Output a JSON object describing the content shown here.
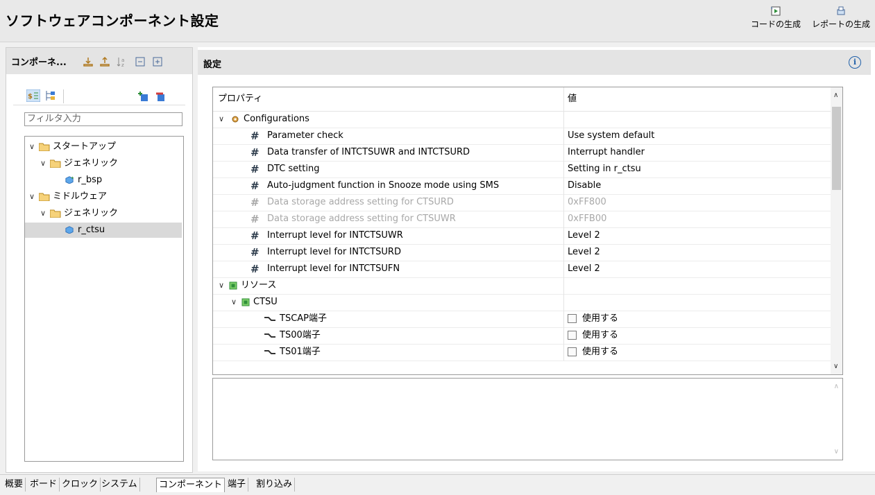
{
  "header": {
    "title": "ソフトウェアコンポーネント設定",
    "generate_code": "コードの生成",
    "generate_report": "レポートの生成"
  },
  "left_panel": {
    "title": "コンポーネ...",
    "filter_placeholder": "フィルタ入力",
    "tree": [
      {
        "label": "スタートアップ",
        "level": 0,
        "type": "folder",
        "expanded": true
      },
      {
        "label": "ジェネリック",
        "level": 1,
        "type": "folder",
        "expanded": true
      },
      {
        "label": "r_bsp",
        "level": 2,
        "type": "component"
      },
      {
        "label": "ミドルウェア",
        "level": 0,
        "type": "folder",
        "expanded": true
      },
      {
        "label": "ジェネリック",
        "level": 1,
        "type": "folder",
        "expanded": true
      },
      {
        "label": "r_ctsu",
        "level": 2,
        "type": "component",
        "selected": true
      }
    ]
  },
  "right_panel": {
    "title": "設定",
    "columns": {
      "property": "プロパティ",
      "value": "値"
    },
    "groups": {
      "configurations": "Configurations",
      "resources": "リソース",
      "ctsu": "CTSU"
    },
    "properties": [
      {
        "name": "Parameter check",
        "value": "Use system default",
        "disabled": false
      },
      {
        "name": "Data transfer of INTCTSUWR and INTCTSURD",
        "value": "Interrupt handler",
        "disabled": false
      },
      {
        "name": "DTC setting",
        "value": "Setting in r_ctsu",
        "disabled": false
      },
      {
        "name": "Auto-judgment function in Snooze mode using SMS",
        "value": "Disable",
        "disabled": false
      },
      {
        "name": "Data storage address setting for CTSURD",
        "value": "0xFF800",
        "disabled": true
      },
      {
        "name": "Data storage address setting for CTSUWR",
        "value": "0xFFB00",
        "disabled": true
      },
      {
        "name": "Interrupt level for INTCTSUWR",
        "value": "Level 2",
        "disabled": false
      },
      {
        "name": "Interrupt level for INTCTSURD",
        "value": "Level 2",
        "disabled": false
      },
      {
        "name": "Interrupt level for INTCTSUFN",
        "value": "Level 2",
        "disabled": false
      }
    ],
    "pins": [
      {
        "name": "TSCAP端子",
        "checkbox_label": "使用する",
        "checked": false
      },
      {
        "name": "TS00端子",
        "checkbox_label": "使用する",
        "checked": false
      },
      {
        "name": "TS01端子",
        "checkbox_label": "使用する",
        "checked": false
      }
    ]
  },
  "tabs": [
    {
      "label": "概要",
      "active": false
    },
    {
      "label": "ボード",
      "active": false
    },
    {
      "label": "クロック",
      "active": false
    },
    {
      "label": "システム",
      "active": false
    },
    {
      "label": "コンポーネント",
      "active": true
    },
    {
      "label": "端子",
      "active": false
    },
    {
      "label": "割り込み",
      "active": false
    }
  ],
  "colors": {
    "accent": "#1f5fa8",
    "folder": "#e8b33a",
    "chip": "#2f8f3a",
    "component": "#3a7bd5"
  }
}
